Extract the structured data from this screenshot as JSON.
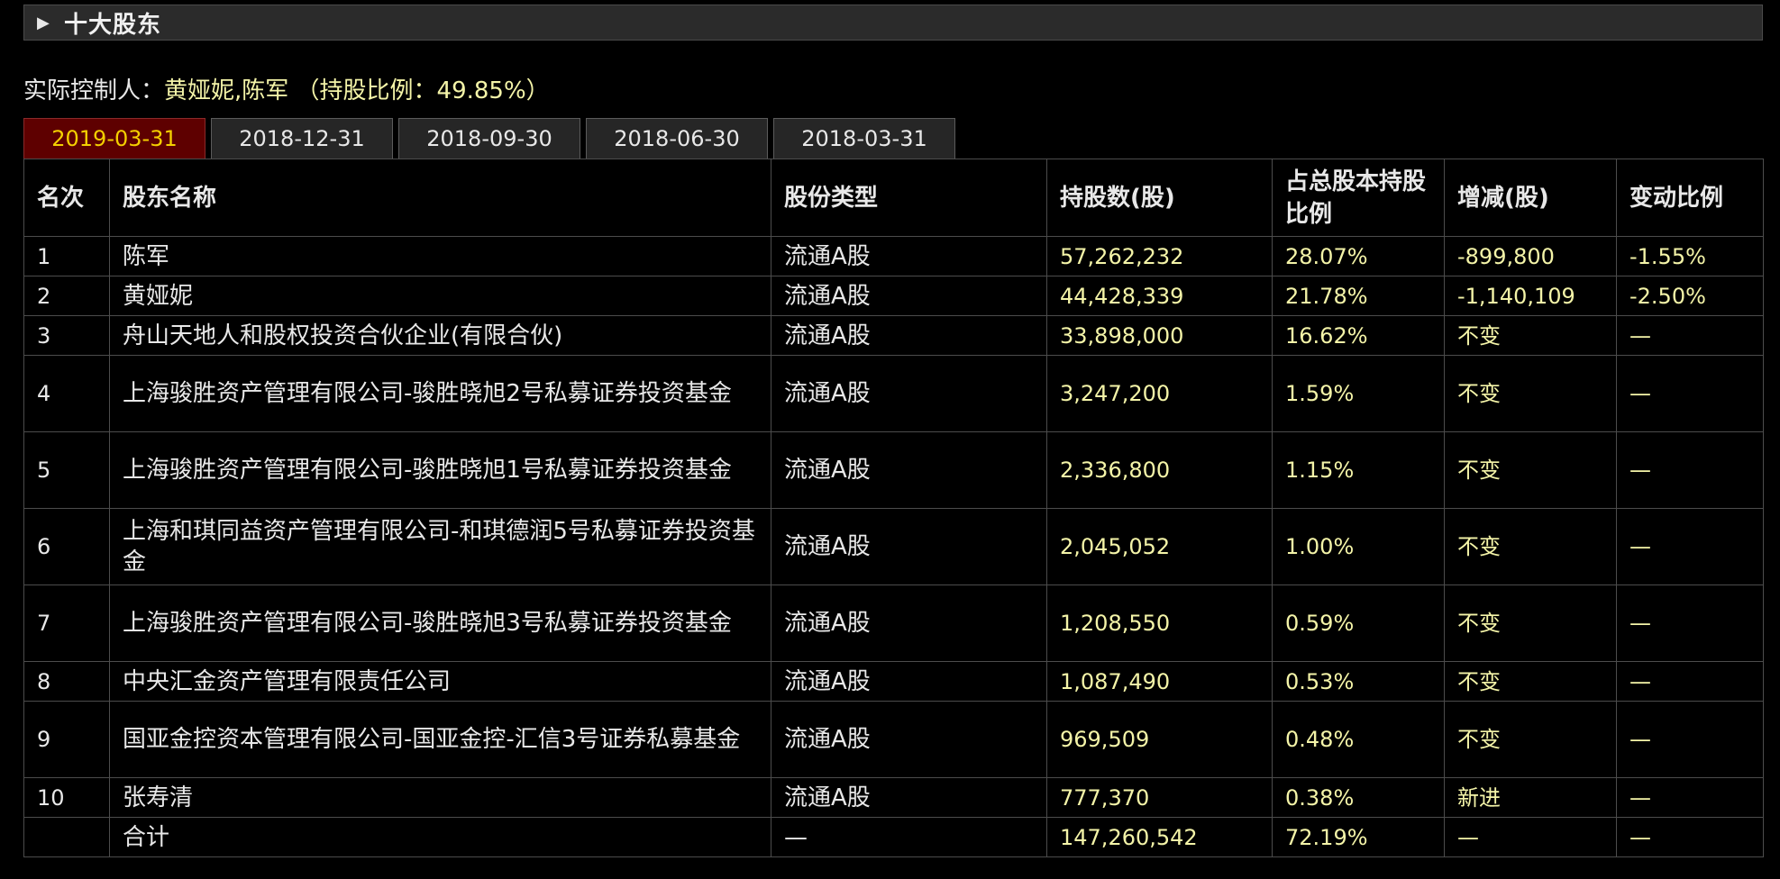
{
  "header": {
    "title": "十大股东"
  },
  "controller": {
    "label": "实际控制人：",
    "names": "黄娅妮,陈军",
    "ratio_text": " （持股比例：49.85%）"
  },
  "tabs": [
    "2019-03-31",
    "2018-12-31",
    "2018-09-30",
    "2018-06-30",
    "2018-03-31"
  ],
  "active_tab": 0,
  "table": {
    "columns": [
      "名次",
      "股东名称",
      "股份类型",
      "持股数(股)",
      "占总股本持股比例",
      "增减(股)",
      "变动比例"
    ],
    "rows": [
      {
        "rank": "1",
        "name": "陈军",
        "type": "流通A股",
        "shares": "57,262,232",
        "pct": "28.07%",
        "change": "-899,800",
        "change_pct": "-1.55%"
      },
      {
        "rank": "2",
        "name": "黄娅妮",
        "type": "流通A股",
        "shares": "44,428,339",
        "pct": "21.78%",
        "change": "-1,140,109",
        "change_pct": "-2.50%"
      },
      {
        "rank": "3",
        "name": "舟山天地人和股权投资合伙企业(有限合伙)",
        "type": "流通A股",
        "shares": "33,898,000",
        "pct": "16.62%",
        "change": "不变",
        "change_pct": "—"
      },
      {
        "rank": "4",
        "name": "上海骏胜资产管理有限公司-骏胜晓旭2号私募证券投资基金",
        "type": "流通A股",
        "shares": "3,247,200",
        "pct": "1.59%",
        "change": "不变",
        "change_pct": "—"
      },
      {
        "rank": "5",
        "name": "上海骏胜资产管理有限公司-骏胜晓旭1号私募证券投资基金",
        "type": "流通A股",
        "shares": "2,336,800",
        "pct": "1.15%",
        "change": "不变",
        "change_pct": "—"
      },
      {
        "rank": "6",
        "name": "上海和琪同益资产管理有限公司-和琪德润5号私募证券投资基金",
        "type": "流通A股",
        "shares": "2,045,052",
        "pct": "1.00%",
        "change": "不变",
        "change_pct": "—"
      },
      {
        "rank": "7",
        "name": "上海骏胜资产管理有限公司-骏胜晓旭3号私募证券投资基金",
        "type": "流通A股",
        "shares": "1,208,550",
        "pct": "0.59%",
        "change": "不变",
        "change_pct": "—"
      },
      {
        "rank": "8",
        "name": "中央汇金资产管理有限责任公司",
        "type": "流通A股",
        "shares": "1,087,490",
        "pct": "0.53%",
        "change": "不变",
        "change_pct": "—"
      },
      {
        "rank": "9",
        "name": "国亚金控资本管理有限公司-国亚金控-汇信3号证券私募基金",
        "type": "流通A股",
        "shares": "969,509",
        "pct": "0.48%",
        "change": "不变",
        "change_pct": "—"
      },
      {
        "rank": "10",
        "name": "张寿清",
        "type": "流通A股",
        "shares": "777,370",
        "pct": "0.38%",
        "change": "新进",
        "change_pct": "—"
      }
    ],
    "total": {
      "rank": "",
      "name": "合计",
      "type": "—",
      "shares": "147,260,542",
      "pct": "72.19%",
      "change": "—",
      "change_pct": "—"
    }
  },
  "colors": {
    "background": "#000000",
    "active_tab_bg": "#5e0000",
    "active_tab_text": "#f4d000",
    "value_text": "#f4f4a8"
  }
}
